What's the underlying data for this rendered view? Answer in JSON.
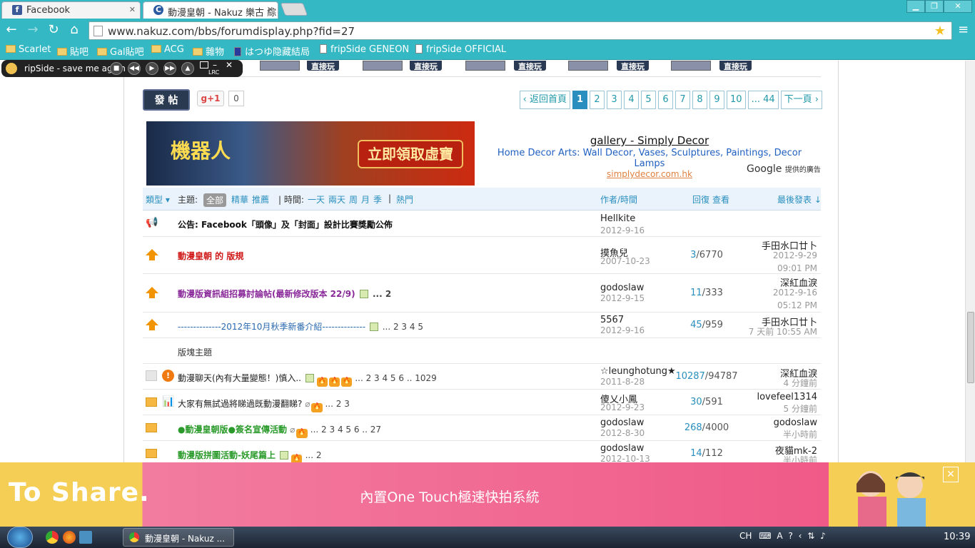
{
  "tabs": [
    {
      "label": "Facebook",
      "favicon": "f",
      "active": false
    },
    {
      "label": "動漫皇朝 - Nakuz 樂古 綜",
      "favicon": "C",
      "active": true
    }
  ],
  "url": "www.nakuz.com/bbs/forumdisplay.php?fid=27",
  "bookmarks": [
    "Scarlet",
    "貼吧",
    "Gal貼吧",
    "ACG",
    "雜物",
    "はつゆ隐藏結局",
    "fripSide GENEON",
    "fripSide OFFICIAL"
  ],
  "player": {
    "track": "ripSide - save me again",
    "mode": "LRC"
  },
  "strip": {
    "game_label": "直接玩"
  },
  "post_button": "發 帖",
  "gplus": {
    "label": "+1",
    "count": "0"
  },
  "pager": {
    "back": "返回首頁",
    "pages": [
      "1",
      "2",
      "3",
      "4",
      "5",
      "6",
      "7",
      "8",
      "9",
      "10"
    ],
    "ellipsis": "... 44",
    "next": "下一頁"
  },
  "ad": {
    "banner_title": "機器人",
    "banner_cta": "立即領取虛寶",
    "text_title": "gallery - Simply Decor",
    "text_desc": "Home Decor Arts: Wall Decor, Vases, Sculptures, Paintings, Decor Lamps",
    "text_url": "simplydecor.com.hk",
    "google": "Google",
    "google_note": "提供的廣告"
  },
  "thead": {
    "type": "類型",
    "subject_label": "主題:",
    "all": "全部",
    "digest": "精華",
    "recommend": "推薦",
    "time_label": "時間:",
    "times": [
      "一天",
      "兩天",
      "周",
      "月",
      "季"
    ],
    "hot": "熱門",
    "author": "作者/時間",
    "replies": "回復",
    "views": "查看",
    "last": "最後發表"
  },
  "announcement": {
    "title": "公告: Facebook「頭像」及「封面」設計比賽獎勵公佈",
    "author": "Hellkite",
    "date": "2012-9-16"
  },
  "sticky": [
    {
      "title": "動漫皇朝 的 版規",
      "color": "#d01818",
      "pages": "",
      "author": "摸魚兒",
      "date": "2007-10-23",
      "replies": "3",
      "views": "6770",
      "last_user": "手田水口廿卜",
      "last_time": "2012-9-29 09:01 PM"
    },
    {
      "title": "動漫版資訊組招募討論帖(最新修改版本 22/9)",
      "color": "#8a2a9a",
      "pages": "... 2",
      "author": "godoslaw",
      "date": "2012-9-15",
      "replies": "11",
      "views": "333",
      "last_user": "深紅血淚",
      "last_time": "2012-9-16 05:12 PM"
    },
    {
      "title": "--------------2012年10月秋季新番介紹--------------",
      "color": "#2a6ab0",
      "pages": "... 2 3 4 5",
      "author": "5567",
      "date": "2012-9-16",
      "replies": "45",
      "views": "959",
      "last_user": "手田水口廿卜",
      "last_time": "7 天前 10:55 AM"
    }
  ],
  "section_label": "版塊主題",
  "threads": [
    {
      "title": "動漫聊天(內有大量變態！)慎入..",
      "color": "#222",
      "pages": "... 2 3 4 5 6 .. 1029",
      "author": "☆leunghotung★",
      "date": "2011-8-28",
      "replies": "10287",
      "views": "94787",
      "last_user": "深紅血淚",
      "last_time": "4 分鐘前"
    },
    {
      "title": "大家有無試過將睇過既動漫翻睇?",
      "color": "#222",
      "pages": "... 2 3",
      "author": "傻乂小鳳",
      "date": "2012-9-23",
      "replies": "30",
      "views": "591",
      "last_user": "lovefeel1314",
      "last_time": "5 分鐘前"
    },
    {
      "title": "●動漫皇朝版●簽名宣傳活動",
      "color": "#2a9a2a",
      "pages": "... 2 3 4 5 6 .. 27",
      "author": "godoslaw",
      "date": "2012-8-30",
      "replies": "268",
      "views": "4000",
      "last_user": "godoslaw",
      "last_time": "半小時前"
    },
    {
      "title": "動漫版拼圖活動-妖尾篇上",
      "color": "#2a9a2a",
      "pages": "... 2",
      "author": "godoslaw",
      "date": "2012-10-13",
      "replies": "14",
      "views": "112",
      "last_user": "夜貓mk-2",
      "last_time": "半小時前"
    }
  ],
  "bottom_ad": {
    "brand": "To Share.",
    "slogan": "內置One Touch極速快拍系統",
    "close": "✕"
  },
  "taskbar": {
    "window": "動漫皇朝 - Nakuz ...",
    "lang": "CH",
    "clock": "10:39"
  }
}
